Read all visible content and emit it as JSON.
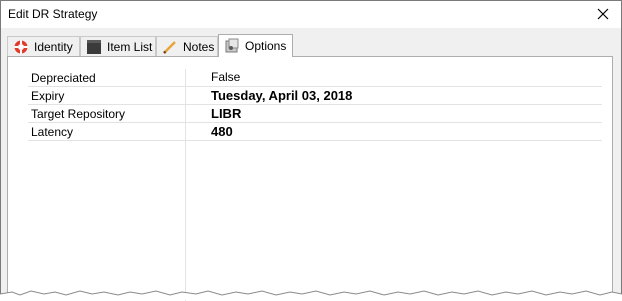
{
  "window": {
    "title": "Edit DR Strategy",
    "close_icon": "close-icon"
  },
  "tabs": [
    {
      "label": "Identity",
      "icon": "lifebuoy-icon",
      "active": false
    },
    {
      "label": "Item List",
      "icon": "item-list-icon",
      "active": false
    },
    {
      "label": "Notes",
      "icon": "pencil-icon",
      "active": false
    },
    {
      "label": "Options",
      "icon": "options-icon",
      "active": true
    }
  ],
  "properties": [
    {
      "key": "Depreciated",
      "value": "False",
      "bold": false
    },
    {
      "key": "Expiry",
      "value": "Tuesday, April 03, 2018",
      "bold": true
    },
    {
      "key": "Target Repository",
      "value": "LIBR",
      "bold": true
    },
    {
      "key": "Latency",
      "value": "480",
      "bold": true
    }
  ],
  "colors": {
    "window_bg": "#f0f0f0",
    "panel_bg": "#ffffff",
    "grid_line": "#e3e3e3",
    "border": "#adadad"
  }
}
